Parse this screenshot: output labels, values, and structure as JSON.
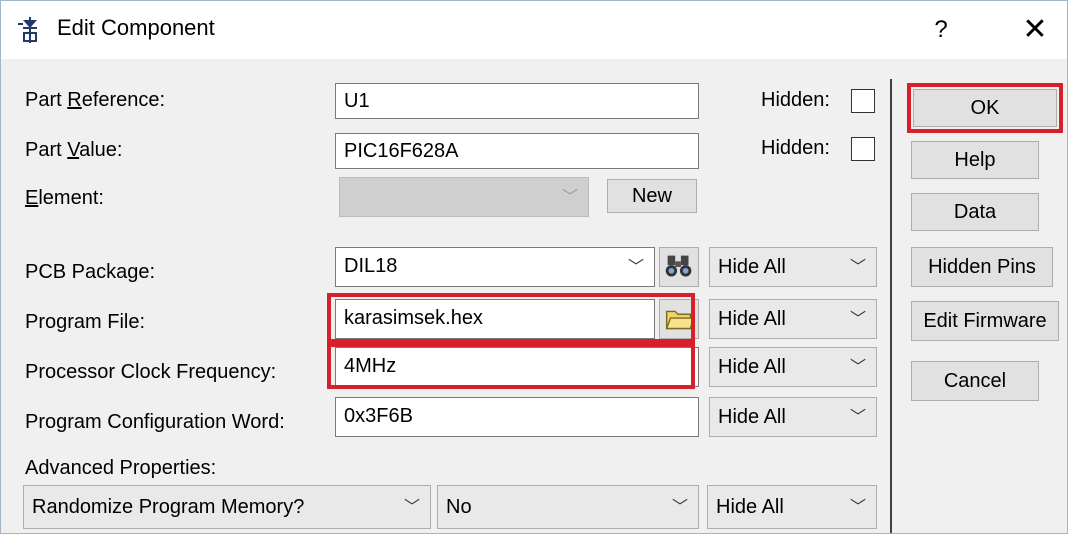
{
  "window": {
    "title": "Edit Component",
    "help_label": "?",
    "close_label": "✕"
  },
  "form": {
    "part_reference": {
      "label_pre": "Part ",
      "label_u": "R",
      "label_post": "eference:",
      "value": "U1",
      "hidden_label": "Hidden:"
    },
    "part_value": {
      "label_pre": "Part ",
      "label_u": "V",
      "label_post": "alue:",
      "value": "PIC16F628A",
      "hidden_label": "Hidden:"
    },
    "element": {
      "label_u": "E",
      "label_post": "lement:",
      "value": "",
      "new_button": "New"
    },
    "pcb_package": {
      "label": "PCB Package:",
      "value": "DIL18",
      "visibility": "Hide All"
    },
    "program_file": {
      "label": "Program File:",
      "value": "karasimsek.hex",
      "visibility": "Hide All"
    },
    "clock_frequency": {
      "label": "Processor Clock Frequency:",
      "value": "4MHz",
      "visibility": "Hide All"
    },
    "config_word": {
      "label": "Program Configuration Word:",
      "value": "0x3F6B",
      "visibility": "Hide All"
    },
    "advanced": {
      "label": "Advanced Properties:",
      "property": "Randomize Program Memory?",
      "value": "No",
      "visibility": "Hide All"
    }
  },
  "buttons": {
    "ok": "OK",
    "help": "Help",
    "data": "Data",
    "hidden_pins": "Hidden Pins",
    "edit_firmware": "Edit Firmware",
    "cancel": "Cancel"
  },
  "icons": {
    "app": "component-icon",
    "search": "binoculars-icon",
    "browse": "folder-icon"
  },
  "colors": {
    "highlight": "#d8202a",
    "background": "#f0f0f0"
  }
}
